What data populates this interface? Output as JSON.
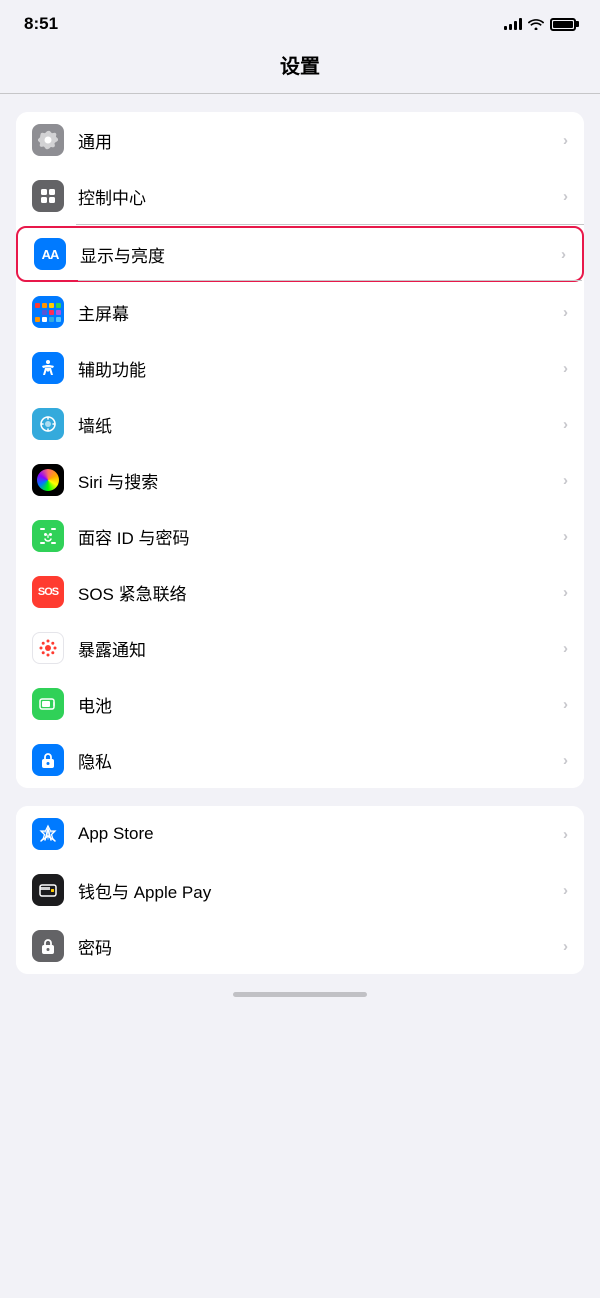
{
  "statusBar": {
    "time": "8:51",
    "signalLabel": "signal",
    "wifiLabel": "wifi",
    "batteryLabel": "battery"
  },
  "pageTitle": "设置",
  "group1": {
    "items": [
      {
        "id": "general",
        "label": "通用",
        "iconType": "gear",
        "iconBg": "#8e8e93",
        "highlighted": false
      },
      {
        "id": "control-center",
        "label": "控制中心",
        "iconType": "toggle",
        "iconBg": "#636366",
        "highlighted": false
      },
      {
        "id": "display",
        "label": "显示与亮度",
        "iconType": "aa",
        "iconBg": "#007aff",
        "highlighted": true
      },
      {
        "id": "homescreen",
        "label": "主屏幕",
        "iconType": "dots",
        "iconBg": "#007aff",
        "highlighted": false
      },
      {
        "id": "accessibility",
        "label": "辅助功能",
        "iconType": "accessibility",
        "iconBg": "#007aff",
        "highlighted": false
      },
      {
        "id": "wallpaper",
        "label": "墙纸",
        "iconType": "wallpaper",
        "iconBg": "#34aadc",
        "highlighted": false
      },
      {
        "id": "siri",
        "label": "Siri 与搜索",
        "iconType": "siri",
        "iconBg": "#000",
        "highlighted": false
      },
      {
        "id": "faceid",
        "label": "面容 ID 与密码",
        "iconType": "faceid",
        "iconBg": "#30d158",
        "highlighted": false
      },
      {
        "id": "sos",
        "label": "SOS 紧急联络",
        "iconType": "sos",
        "iconBg": "#ff3b30",
        "highlighted": false
      },
      {
        "id": "exposure",
        "label": "暴露通知",
        "iconType": "exposure",
        "iconBg": "#ffffff",
        "highlighted": false
      },
      {
        "id": "battery",
        "label": "电池",
        "iconType": "battery",
        "iconBg": "#30d158",
        "highlighted": false
      },
      {
        "id": "privacy",
        "label": "隐私",
        "iconType": "privacy",
        "iconBg": "#007aff",
        "highlighted": false
      }
    ]
  },
  "group2": {
    "items": [
      {
        "id": "appstore",
        "label": "App Store",
        "iconType": "appstore",
        "iconBg": "#007aff",
        "highlighted": false
      },
      {
        "id": "wallet",
        "label": "钱包与 Apple Pay",
        "iconType": "wallet",
        "iconBg": "#000000",
        "highlighted": false
      },
      {
        "id": "passwords",
        "label": "密码",
        "iconType": "passwords",
        "iconBg": "#636366",
        "highlighted": false
      }
    ]
  },
  "chevron": "›"
}
